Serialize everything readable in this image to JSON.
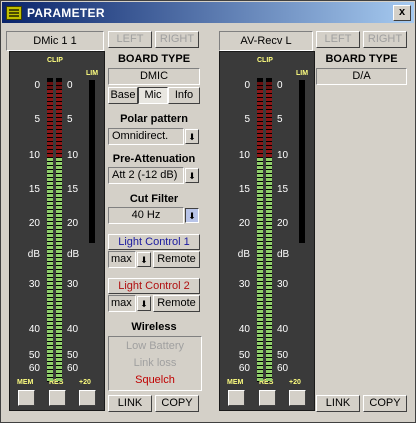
{
  "window": {
    "title": "PARAMETER",
    "close_label": "x"
  },
  "left": {
    "channel_name": "DMic 1 1",
    "left_label": "LEFT",
    "right_label": "RIGHT",
    "meter": {
      "clip_label": "CLIP",
      "lim_label": "LIM",
      "left_ticks": [
        "0",
        "5",
        "10",
        "15",
        "20",
        "dB",
        "30",
        "40",
        "50",
        "60"
      ],
      "right_ticks": [
        "0",
        "5",
        "10",
        "15",
        "20",
        "dB",
        "30",
        "40",
        "50",
        "60"
      ],
      "level_db": 10,
      "mem_label": "MEM",
      "res_label": "RES",
      "plus20_label": "+20"
    },
    "link_label": "LINK",
    "copy_label": "COPY"
  },
  "middle": {
    "board_type_heading": "BOARD TYPE",
    "board_type_value": "DMIC",
    "tabs": [
      "Base",
      "Mic",
      "Info"
    ],
    "active_tab": "Mic",
    "polar_heading": "Polar pattern",
    "polar_value": "Omnidirect.",
    "preatt_heading": "Pre-Attenuation",
    "preatt_value": "Att 2 (-12 dB)",
    "cut_heading": "Cut Filter",
    "cut_value": "40 Hz",
    "lc1_label": "Light Control 1",
    "lc1_color": "#1a1aa0",
    "lc1_mode": "max",
    "lc1_remote": "Remote",
    "lc2_label": "Light Control 2",
    "lc2_color": "#b01010",
    "lc2_mode": "max",
    "lc2_remote": "Remote",
    "wireless_heading": "Wireless",
    "wireless_items": [
      "Low Battery",
      "Link loss",
      "Squelch"
    ],
    "squelch_color": "#c00000"
  },
  "right": {
    "channel_name": "AV-Recv L",
    "left_label": "LEFT",
    "right_label": "RIGHT",
    "board_type_heading": "BOARD TYPE",
    "board_type_value": "D/A",
    "meter": {
      "clip_label": "CLIP",
      "lim_label": "LIM",
      "left_ticks": [
        "0",
        "5",
        "10",
        "15",
        "20",
        "dB",
        "30",
        "40",
        "50",
        "60"
      ],
      "right_ticks": [
        "0",
        "5",
        "10",
        "15",
        "20",
        "dB",
        "30",
        "40",
        "50",
        "60"
      ],
      "level_db": 10,
      "mem_label": "MEM",
      "res_label": "RES",
      "plus20_label": "+20"
    },
    "link_label": "LINK",
    "copy_label": "COPY"
  }
}
